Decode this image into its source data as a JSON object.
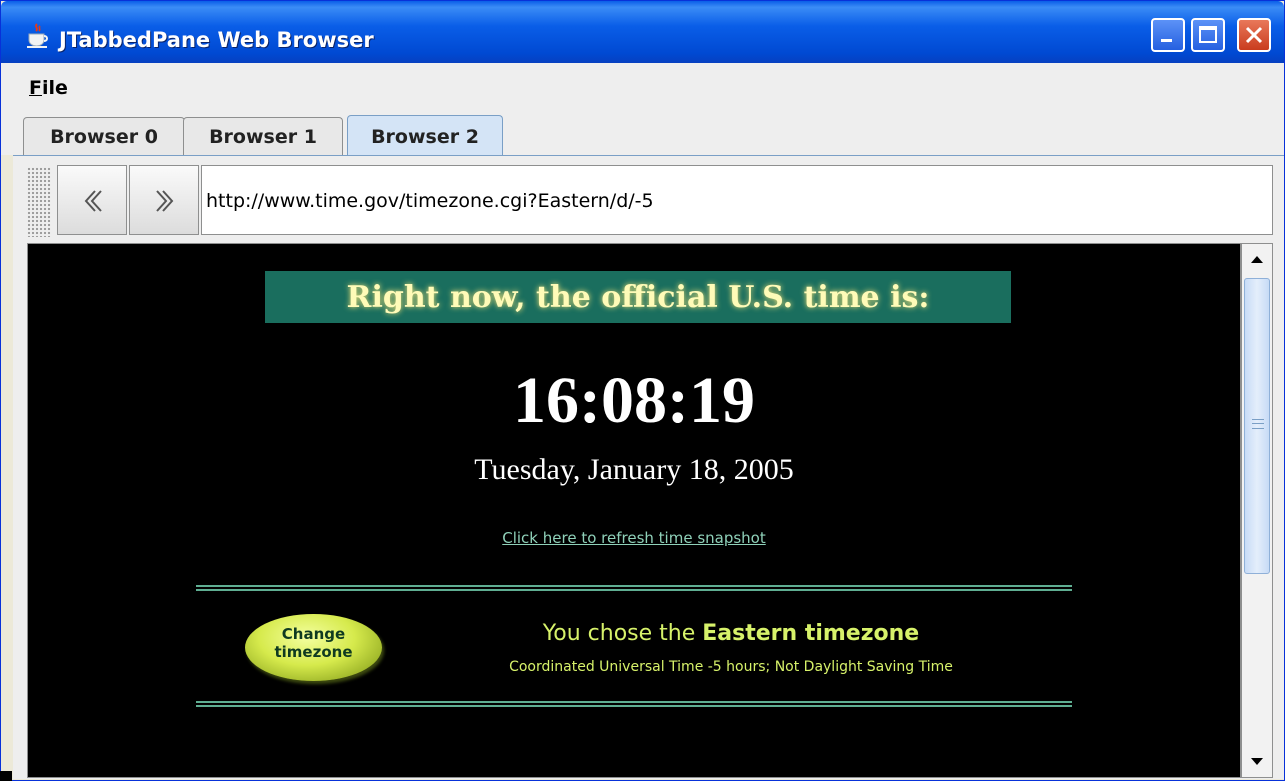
{
  "window": {
    "title": "JTabbedPane Web Browser",
    "icon": "java-cup-icon",
    "controls": [
      "minimize-icon",
      "maximize-icon",
      "close-icon"
    ]
  },
  "menubar": {
    "file_label": "File",
    "file_mnemonic": "F",
    "file_rest": "ile"
  },
  "tabs": [
    {
      "label": "Browser 0",
      "selected": false
    },
    {
      "label": "Browser 1",
      "selected": false
    },
    {
      "label": "Browser 2",
      "selected": true
    }
  ],
  "toolbar": {
    "back_icon": "chevron-left-icon",
    "forward_icon": "chevron-right-icon",
    "url": "http://www.time.gov/timezone.cgi?Eastern/d/-5"
  },
  "page": {
    "banner": "Right now, the official U.S. time is:",
    "time": "16:08:19",
    "date": "Tuesday, January 18, 2005",
    "refresh_link": "Click here to refresh time snapshot",
    "change_button_line1": "Change",
    "change_button_line2": "timezone",
    "chose_prefix": "You chose the ",
    "chose_zone": "Eastern timezone",
    "utc_note": "Coordinated Universal Time -5 hours; Not Daylight Saving Time"
  },
  "colors": {
    "titlebar": "#0a5ee8",
    "banner_bg": "#1a6e5e",
    "banner_text": "#fffbb8",
    "page_bg": "#000000",
    "accent_text": "#d7f26a",
    "link": "#8fd1b9",
    "selected_tab": "#d4e4f6"
  }
}
